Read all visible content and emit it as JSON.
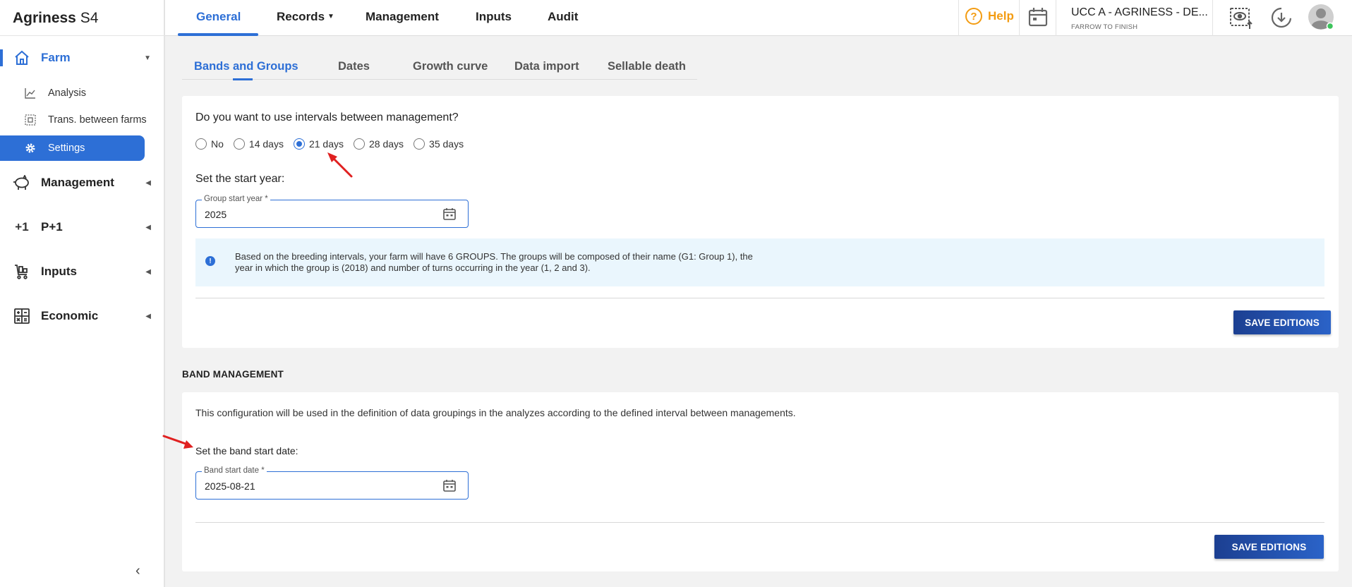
{
  "brand": {
    "name": "Agriness",
    "suffix": "S4"
  },
  "sidebar": {
    "sections": [
      {
        "label": "Farm",
        "icon": "house-icon"
      },
      {
        "label": "Management",
        "icon": "pig-icon"
      },
      {
        "label": "P+1",
        "icon": "plus-one-icon"
      },
      {
        "label": "Inputs",
        "icon": "cart-icon"
      },
      {
        "label": "Economic",
        "icon": "calculator-icon"
      }
    ],
    "farm_items": [
      {
        "label": "Analysis",
        "icon": "chart-line-icon"
      },
      {
        "label": "Trans. between farms",
        "icon": "transfer-icon"
      },
      {
        "label": "Settings",
        "icon": "gear-icon"
      }
    ],
    "plus_one_glyph": "+1"
  },
  "topnav": {
    "tabs": [
      "General",
      "Records",
      "Management",
      "Inputs",
      "Audit"
    ],
    "help_label": "Help",
    "help_glyph": "?",
    "farm_name": "UCC A - AGRINESS - DE...",
    "farm_subtitle": "FARROW TO FINISH"
  },
  "subtabs": [
    "Bands and Groups",
    "Dates",
    "Growth curve",
    "Data import",
    "Sellable death"
  ],
  "intervals": {
    "question": "Do you want to use intervals between management?",
    "options": [
      "No",
      "14 days",
      "21 days",
      "28 days",
      "35 days"
    ],
    "selected": "21 days",
    "start_year_label": "Set the start year:",
    "year_field": {
      "label": "Group start year *",
      "value": "2025"
    },
    "info_glyph": "!",
    "info_text": "Based on the breeding intervals, your farm will have 6 GROUPS. The groups will be composed of their name (G1: Group 1), the year in which the group is (2018) and number of turns occurring in the year (1, 2 and 3).",
    "save_label": "SAVE EDITIONS"
  },
  "band": {
    "title": "BAND MANAGEMENT",
    "description": "This configuration will be used in the definition of data groupings in the analyzes according to the defined interval between managements.",
    "start_label": "Set the band start date:",
    "date_field": {
      "label": "Band start date *",
      "value": "2025-08-21"
    },
    "save_label": "SAVE EDITIONS"
  },
  "colors": {
    "accent": "#2d6fd6",
    "help": "#f39c12",
    "button": "#1c3f91",
    "info_bg": "#eaf6fd",
    "annotation": "#e02020"
  }
}
